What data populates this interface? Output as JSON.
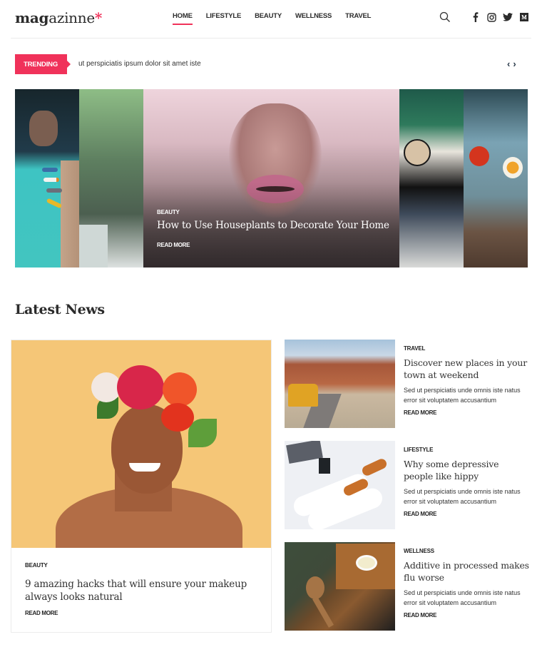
{
  "brand": {
    "logo_bold": "mag",
    "logo_regular": "azinne",
    "logo_mark": "*",
    "accent_color": "#f0325a"
  },
  "nav": {
    "items": [
      {
        "label": "HOME",
        "active": true
      },
      {
        "label": "LIFESTYLE",
        "active": false
      },
      {
        "label": "BEAUTY",
        "active": false
      },
      {
        "label": "WELLNESS",
        "active": false
      },
      {
        "label": "TRAVEL",
        "active": false
      }
    ]
  },
  "header_icons": [
    "search-icon",
    "facebook-icon",
    "instagram-icon",
    "twitter-icon",
    "medium-icon"
  ],
  "trending": {
    "badge": "TRENDING",
    "text": "ut perspiciatis ipsum dolor sit amet iste",
    "prev": "‹",
    "next": "›"
  },
  "hero": {
    "category": "BEAUTY",
    "title": "How to Use Houseplants to Decorate Your Home",
    "read_more": "READ MORE"
  },
  "latest": {
    "title": "Latest News",
    "featured": {
      "category": "BEAUTY",
      "title": "9 amazing hacks that will ensure your makeup always looks natural",
      "read_more": "READ MORE"
    },
    "items": [
      {
        "category": "TRAVEL",
        "title": "Discover new places in your town at weekend",
        "excerpt": "Sed ut perspiciatis unde omnis iste natus error sit voluptatem accusantium",
        "read_more": "READ MORE"
      },
      {
        "category": "LIFESTYLE",
        "title": "Why some depressive people like hippy",
        "excerpt": "Sed ut perspiciatis unde omnis iste natus error sit voluptatem accusantium",
        "read_more": "READ MORE"
      },
      {
        "category": "WELLNESS",
        "title": "Additive in processed makes flu worse",
        "excerpt": "Sed ut perspiciatis unde omnis iste natus error sit voluptatem accusantium",
        "read_more": "READ MORE"
      }
    ]
  }
}
